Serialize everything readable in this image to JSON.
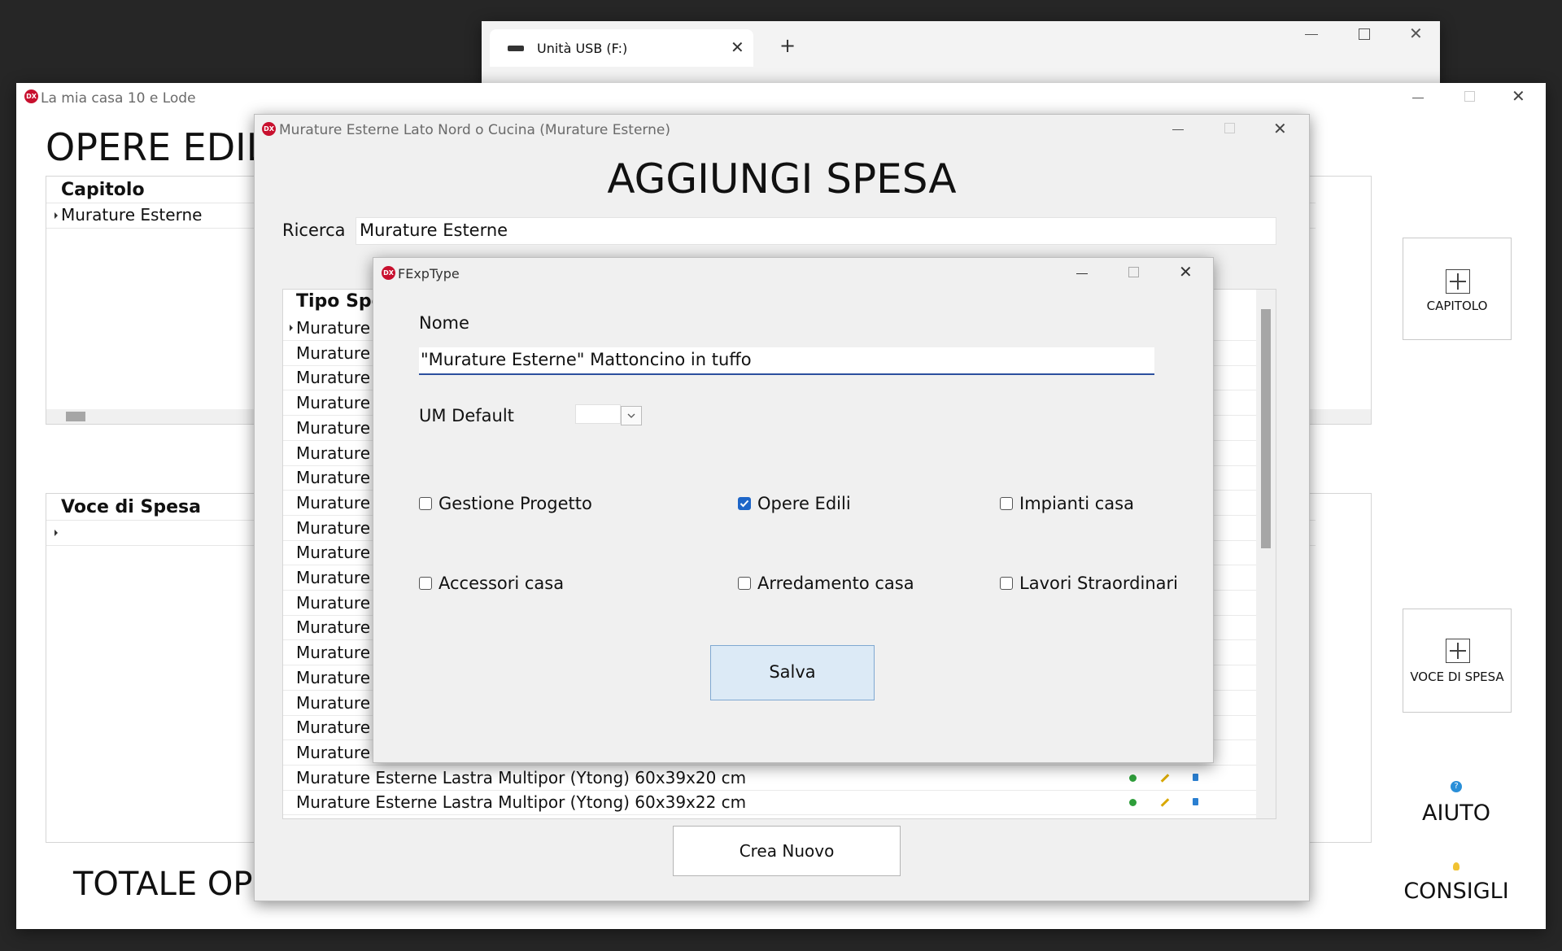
{
  "explorer": {
    "tab_title": "Unità USB (F:)",
    "new_tab": "+"
  },
  "main_window": {
    "title": "La mia casa 10 e Lode",
    "heading": "OPERE EDIL",
    "chapter_grid": {
      "header": "Capitolo",
      "rows": [
        "Murature Esterne"
      ]
    },
    "item_grid": {
      "header": "Voce di Spesa"
    },
    "total": "TOTALE OPE",
    "buttons": {
      "capitolo": "CAPITOLO",
      "voce": "VOCE DI SPESA",
      "help": "AIUTO",
      "tips": "CONSIGLI"
    }
  },
  "add_window": {
    "title": "Murature Esterne Lato Nord o Cucina (Murature Esterne)",
    "heading": "AGGIUNGI SPESA",
    "search_label": "Ricerca",
    "search_value": "Murature Esterne",
    "grid_header": "Tipo Spe",
    "rows": [
      "Murature E",
      "Murature E",
      "Murature E",
      "Murature E",
      "Murature E",
      "Murature E",
      "Murature E",
      "Murature E",
      "Murature E",
      "Murature E",
      "Murature E",
      "Murature E",
      "Murature E",
      "Murature E",
      "Murature E",
      "Murature E",
      "Murature E",
      "Murature E",
      "Murature Esterne Lastra Multipor (Ytong) 60x39x20 cm",
      "Murature Esterne Lastra Multipor (Ytong) 60x39x22 cm"
    ],
    "create_button": "Crea Nuovo"
  },
  "dialog": {
    "title": "FExpType",
    "name_label": "Nome",
    "name_value": "\"Murature Esterne\" Mattoncino in tuffo",
    "um_label": "UM Default",
    "um_value": "",
    "checkboxes": [
      {
        "label": "Gestione Progetto",
        "checked": false
      },
      {
        "label": "Opere Edili",
        "checked": true
      },
      {
        "label": "Impianti casa",
        "checked": false
      },
      {
        "label": "Accessori casa",
        "checked": false
      },
      {
        "label": "Arredamento casa",
        "checked": false
      },
      {
        "label": "Lavori Straordinari",
        "checked": false
      }
    ],
    "save_button": "Salva"
  },
  "colors": {
    "accent": "#1e66c8",
    "save_bg": "#dceaf6",
    "dx_logo": "#c8102e"
  }
}
